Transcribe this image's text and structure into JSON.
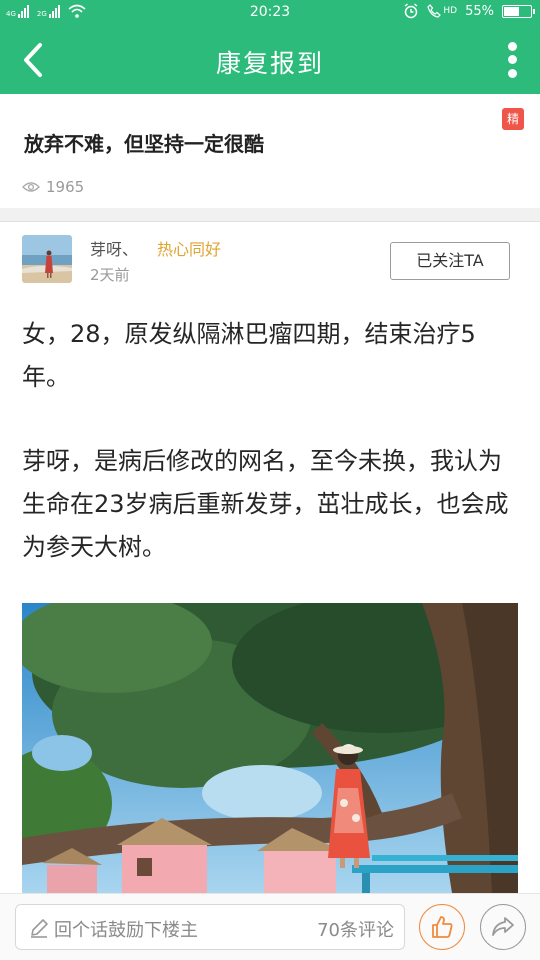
{
  "status_bar": {
    "signal1_label": "4G",
    "signal2_label": "2G",
    "time": "20:23",
    "network": "HD",
    "battery_text": "55%",
    "battery_level": 0.55
  },
  "header": {
    "title": "康复报到"
  },
  "post": {
    "badge": "精",
    "title": "放弃不难，但坚持一定很酷",
    "views": "1965"
  },
  "author": {
    "name": "芽呀、",
    "tag": "热心同好",
    "time": "2天前",
    "follow_label": "已关注TA"
  },
  "content": {
    "paragraph1": "女，28，原发纵隔淋巴瘤四期，结束治疗5年。",
    "paragraph2": "芽呀，是病后修改的网名，至今未换，我认为生命在23岁病后重新发芽，茁壮成长，也会成为参天大树。"
  },
  "bottom_bar": {
    "comment_placeholder": "回个话鼓励下楼主",
    "comment_count": "70条评论"
  },
  "icons": {
    "back": "back-arrow-icon",
    "more": "more-vertical-icon",
    "views": "eye-icon",
    "comment": "pencil-icon",
    "like": "thumbs-up-icon",
    "share": "share-icon"
  },
  "colors": {
    "brand_green": "#2dbb7c",
    "badge_red": "#f0554a",
    "tag_orange": "#e0a430",
    "like_orange": "#f08a3e"
  }
}
